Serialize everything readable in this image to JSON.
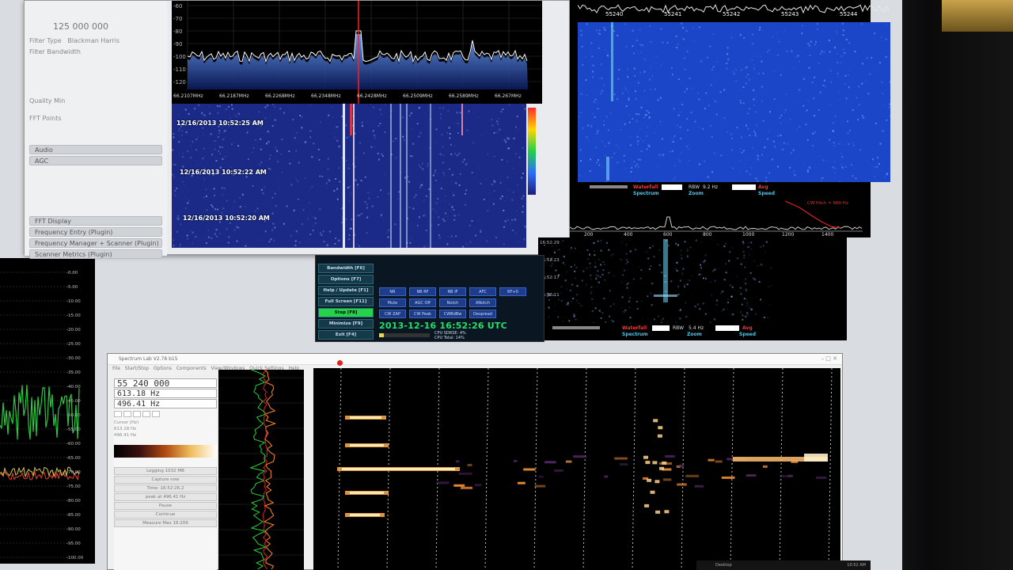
{
  "left_window": {
    "freq_display": "125 000 000",
    "option_labels": [
      "Filter Type",
      "Filter Bandwidth",
      "Quality Min",
      "FFT Points"
    ],
    "filter_type_value": "Blackman Harris",
    "groups": [
      "Audio",
      "AGC",
      "FFT Display",
      "Frequency Entry (Plugin)",
      "Frequency Manager + Scanner (Plugin)",
      "Scanner Metrics (Plugin)"
    ],
    "db_ticks": [
      "-60",
      "-70",
      "-80",
      "-90",
      "-100",
      "-110",
      "-120"
    ],
    "freq_ticks": [
      "66.2107MHz",
      "66.2187MHz",
      "66.2268MHz",
      "66.2348MHz",
      "66.2428MHz",
      "66.2509MHz",
      "66.2589MHz",
      "66.267MHz"
    ],
    "timestamps": [
      "12/16/2013 10:52:25 AM",
      "12/16/2013 10:52:22 AM",
      "12/16/2013 10:52:20 AM"
    ]
  },
  "sdr_top": {
    "freq_ticks": [
      "55240",
      "55241",
      "55242",
      "55243",
      "55244"
    ],
    "waterfall_label": "Waterfall",
    "spectrum_label": "Spectrum",
    "rbw_label": "RBW",
    "rbw_value": "9.2 Hz",
    "zoom_label": "Zoom",
    "avg_label": "Avg",
    "speed_label": "Speed",
    "audio_ticks": [
      "200",
      "400",
      "600",
      "800",
      "1000",
      "1200",
      "1400"
    ],
    "cw_pitch": "CW Pitch = 600 Hz"
  },
  "sdr_bottom": {
    "waterfall_label": "Waterfall",
    "spectrum_label": "Spectrum",
    "rbw_label": "RBW",
    "rbw_value": "5.4 Hz",
    "zoom_label": "Zoom",
    "avg_label": "Avg",
    "speed_label": "Speed",
    "time_ticks": [
      "16:52:29",
      "16:52:23",
      "16:52:17",
      "16:52:11"
    ]
  },
  "control_panel": {
    "side_buttons": [
      "Bandwidth [F6]",
      "Options [F7]",
      "Help / Update [F1]",
      "Full Screen [F11]",
      "Stop [F8]",
      "Minimize [F9]",
      "Exit [F4]"
    ],
    "dsp_row1": [
      "NR",
      "NB RF",
      "NB IF",
      "AFC",
      "RF+0"
    ],
    "dsp_row2": [
      "Mute",
      "AGC Off",
      "Notch",
      "ANotch"
    ],
    "dsp_row3": [
      "CW ZAP",
      "CW Peak",
      "CWBdBw",
      "Despread"
    ],
    "datetime": "2013-12-16   16:52:26 UTC",
    "cpu_sdr": "CPU SDRSE: 4%",
    "cpu_total": "CPU Total: 14%"
  },
  "spectrum_lab": {
    "title": "Spectrum Lab V2.78 b15",
    "menu": [
      "File",
      "Start/Stop",
      "Options",
      "Components",
      "View/Windows",
      "Quick Settings",
      "Help"
    ],
    "freq_readout": "55 240 000",
    "offset_readout": "613.18 Hz",
    "peak_readout": "496.41 Hz",
    "small_labels": [
      "Cursor (Hz)",
      "613.18 Hz",
      "496.41 Hz"
    ],
    "side_buttons": [
      "Logging 1032 MB",
      "Capture now",
      "Time: 16:52:26.2",
      "peak at 496.41 Hz",
      "Pause",
      "Continue",
      "Measure Max 16:209"
    ],
    "db_ticks": [
      "-40",
      "-45",
      "-50",
      "-55",
      "-60",
      "-65",
      "-70"
    ]
  },
  "left_spectrum": {
    "db_ticks": [
      "-0.00",
      "-5.00",
      "-10.00",
      "-15.00",
      "-20.00",
      "-25.00",
      "-30.00",
      "-35.00",
      "-40.00",
      "-45.00",
      "-50.00",
      "-55.00",
      "-60.00",
      "-65.00",
      "-70.00",
      "-75.00",
      "-80.00",
      "-85.00",
      "-90.00",
      "-95.00",
      "-100.00"
    ]
  },
  "taskbar": {
    "desktop_label": "Desktop",
    "clock": "10:52 AM"
  },
  "colors": {
    "waterfall_blue": "#1b46c8",
    "signal_green": "#22e06a",
    "label_red": "#ff3030",
    "label_cyan": "#2fd0ff"
  }
}
